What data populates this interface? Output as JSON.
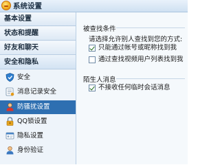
{
  "window": {
    "title": "系统设置"
  },
  "sidebar": {
    "groups": [
      {
        "label": "基本设置"
      },
      {
        "label": "状态和提醒"
      },
      {
        "label": "好友和聊天"
      },
      {
        "label": "安全和隐私"
      }
    ],
    "items": [
      {
        "label": "安全",
        "icon": "shield-icon"
      },
      {
        "label": "消息记录安全",
        "icon": "message-record-icon"
      },
      {
        "label": "防骚扰设置",
        "icon": "anti-harassment-icon",
        "selected": true
      },
      {
        "label": "QQ锁设置",
        "icon": "qq-lock-icon"
      },
      {
        "label": "隐私设置",
        "icon": "privacy-icon"
      },
      {
        "label": "身份验证",
        "icon": "identity-icon"
      }
    ]
  },
  "main": {
    "find_section": {
      "title": "被查找条件",
      "description": "请选择允许别人查找到您的方式:",
      "options": [
        {
          "label": "只能通过帐号或昵称找到我",
          "checked": true
        },
        {
          "label": "通过查找视频用户列表找到我",
          "checked": false
        }
      ]
    },
    "stranger_section": {
      "title": "陌生人消息",
      "options": [
        {
          "label": "不接收任何临时会话消息",
          "checked": true
        }
      ]
    }
  },
  "colors": {
    "selected_bg": "#2e6fb1",
    "titlebar": "#cfe0f1",
    "sidebar_bg": "#eef4fa"
  }
}
